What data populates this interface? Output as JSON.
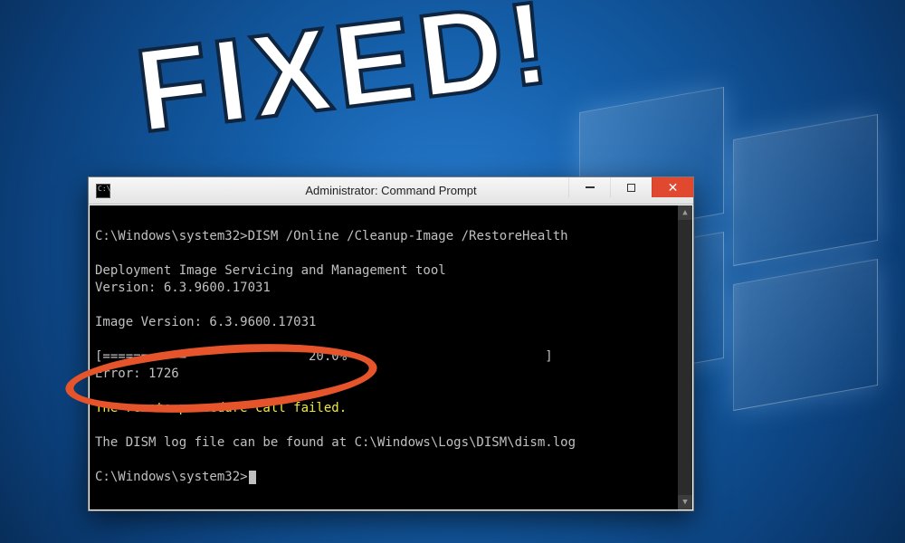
{
  "overlay": {
    "fixed_text": "FIXED!"
  },
  "window": {
    "title": "Administrator: Command Prompt",
    "buttons": {
      "minimize_label": "Minimize",
      "maximize_label": "Maximize",
      "close_label": "Close"
    }
  },
  "terminal": {
    "prompt1": "C:\\Windows\\system32>",
    "command": "DISM /Online /Cleanup-Image /RestoreHealth",
    "blank1": "",
    "tool_line": "Deployment Image Servicing and Management tool",
    "version_line": "Version: 6.3.9600.17031",
    "blank2": "",
    "image_version_line": "Image Version: 6.3.9600.17031",
    "blank3": "",
    "progress_line": "[===========                20.0%                          ]",
    "error_line": "Error: 1726",
    "blank4": "",
    "error_msg": "The remote procedure call failed.",
    "blank5": "",
    "log_line": "The DISM log file can be found at C:\\Windows\\Logs\\DISM\\dism.log",
    "blank6": "",
    "prompt2": "C:\\Windows\\system32>"
  }
}
